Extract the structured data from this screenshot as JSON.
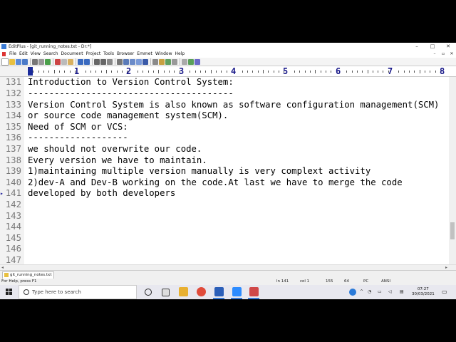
{
  "window": {
    "title": "EditPlus - [git_running_notes.txt - Dr:*]",
    "controls": [
      "–",
      "□",
      "✕"
    ]
  },
  "menu": {
    "items": [
      "File",
      "Edit",
      "View",
      "Search",
      "Document",
      "Project",
      "Tools",
      "Browser",
      "Emmet",
      "Window",
      "Help"
    ],
    "mdi_controls": [
      "–",
      "▫",
      "✕"
    ]
  },
  "ruler": {
    "labels": [
      "1",
      "2",
      "3",
      "4",
      "5",
      "6",
      "7",
      "8"
    ]
  },
  "editor": {
    "lines": [
      {
        "n": "131",
        "text": "Introduction to Version Control System:"
      },
      {
        "n": "132",
        "text": "---------------------------------------"
      },
      {
        "n": "133",
        "text": "Version Control System is also known as software configuration management(SCM)"
      },
      {
        "n": "134",
        "text": "or source code management system(SCM)."
      },
      {
        "n": "135",
        "text": "Need of SCM or VCS:"
      },
      {
        "n": "136",
        "text": "-------------------"
      },
      {
        "n": "137",
        "text": "we should not overwrite our code."
      },
      {
        "n": "138",
        "text": "Every version we have to maintain."
      },
      {
        "n": "139",
        "text": "1)maintaining multiple version manually is very complext activity"
      },
      {
        "n": "140",
        "text": "2)dev-A and Dev-B working on the code.At last we have to merge the code"
      },
      {
        "n": "141",
        "text": "developed by both developers",
        "marker": "▸"
      },
      {
        "n": "142",
        "text": ""
      },
      {
        "n": "143",
        "text": ""
      },
      {
        "n": "144",
        "text": ""
      },
      {
        "n": "145",
        "text": ""
      },
      {
        "n": "146",
        "text": ""
      },
      {
        "n": "147",
        "text": ""
      }
    ]
  },
  "file_tab": {
    "label": "git_running_notes.txt"
  },
  "status": {
    "help": "For Help, press F1",
    "line": "ln 141",
    "col": "col 1",
    "count1": "155",
    "count2": "64",
    "format": "PC",
    "encoding": "ANSI"
  },
  "taskbar": {
    "search_placeholder": "Type here to search",
    "time": "07:27",
    "date": "30/03/2021"
  },
  "colors": {
    "ruler_numbers": "#1a1a8a",
    "cursor_block": "#1a2a9a",
    "taskbar_accent": "#3a7bd5"
  }
}
